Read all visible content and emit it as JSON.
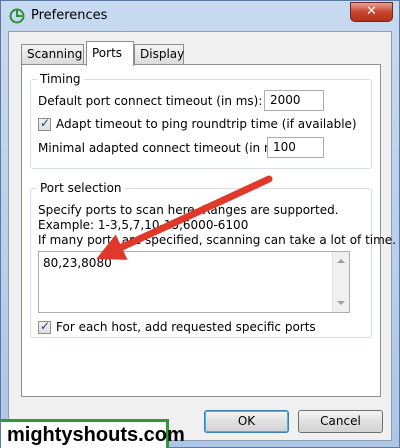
{
  "window": {
    "title": "Preferences",
    "close_label": "✕"
  },
  "tabs": [
    {
      "label": "Scanning",
      "active": false
    },
    {
      "label": "Ports",
      "active": true
    },
    {
      "label": "Display",
      "active": false
    }
  ],
  "timing": {
    "legend": "Timing",
    "default_timeout_label": "Default port connect timeout (in ms):",
    "default_timeout_value": "2000",
    "adapt_label": "Adapt timeout to ping roundtrip time (if available)",
    "adapt_checked": true,
    "minimal_timeout_label": "Minimal adapted connect timeout (in ms):",
    "minimal_timeout_value": "100"
  },
  "port_selection": {
    "legend": "Port selection",
    "line1": "Specify ports to scan here. Ranges are supported.",
    "line2": "Example: 1-3,5,7,10-15,6000-6100",
    "line3": "If many ports are specified, scanning can take a lot of time.",
    "ports_value": "80,23,8080",
    "each_host_label": "For each host, add requested specific ports",
    "each_host_checked": true
  },
  "buttons": {
    "ok": "OK",
    "cancel": "Cancel"
  },
  "watermark": "mightyshouts.com",
  "colors": {
    "annotation_arrow": "#e0392b",
    "watermark_border": "#2e9a3a"
  }
}
